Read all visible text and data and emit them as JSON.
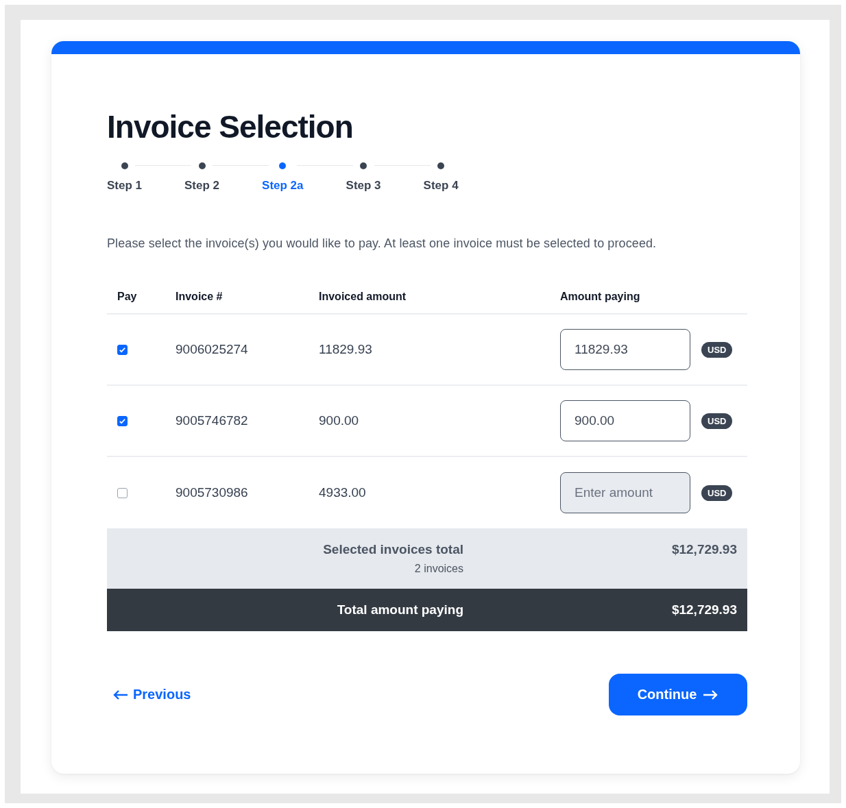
{
  "title": "Invoice Selection",
  "steps": [
    {
      "label": "Step 1",
      "selected": false
    },
    {
      "label": "Step 2",
      "selected": false
    },
    {
      "label": "Step 2a",
      "selected": true
    },
    {
      "label": "Step 3",
      "selected": false
    },
    {
      "label": "Step 4",
      "selected": false
    }
  ],
  "instructions": "Please select the invoice(s) you would like to pay. At least one invoice must be selected to proceed.",
  "table": {
    "columns": [
      "Pay",
      "Invoice #",
      "Invoiced amount",
      "Amount paying"
    ],
    "rows": [
      {
        "checked": true,
        "invoice": "9006025274",
        "invoiced": "11829.93",
        "amount": {
          "value": "11829.93",
          "disabled": false
        },
        "currency": "USD"
      },
      {
        "checked": true,
        "invoice": "9005746782",
        "invoiced": "900.00",
        "amount": {
          "value": "900.00",
          "disabled": false
        },
        "currency": "USD"
      },
      {
        "checked": false,
        "invoice": "9005730986",
        "invoiced": "4933.00",
        "amount": {
          "placeholder": "Enter amount",
          "disabled": true
        },
        "currency": "USD"
      }
    ]
  },
  "summary": {
    "label": "Selected invoices total",
    "sublabel": "2 invoices",
    "value": "$12,729.93"
  },
  "total": {
    "label": "Total amount paying",
    "value": "$12,729.93"
  },
  "buttons": {
    "previous": "Previous",
    "continue": "Continue"
  }
}
